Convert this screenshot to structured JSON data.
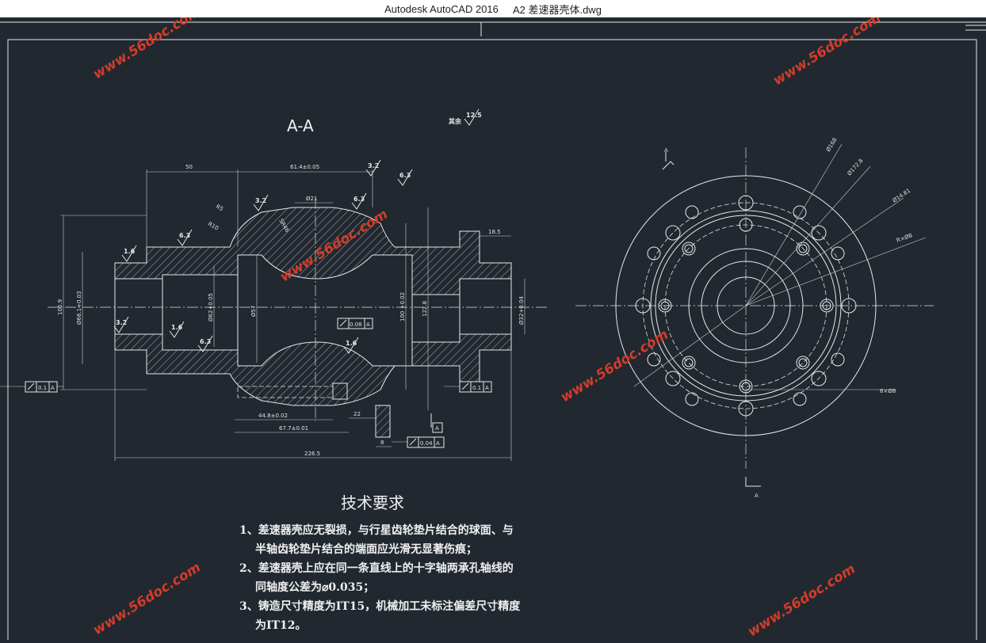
{
  "window": {
    "app": "Autodesk AutoCAD 2016",
    "file": "A2 差速器壳体.dwg"
  },
  "drawing": {
    "section_label": "A-A",
    "rough_all": "其余",
    "rough_all_value": "12.5",
    "roughness": [
      "3.2",
      "6.3",
      "1.6",
      "3.2",
      "6.3",
      "6.3",
      "3.2",
      "6.3",
      "1.6",
      "6.3",
      "1.6",
      "3.2",
      "1.6"
    ],
    "dims": {
      "d50": "50",
      "d61": "61.4±0.05",
      "d18": "18.5",
      "r5": "R5",
      "r10": "R10",
      "sr": "SR46",
      "phi21": "Ø21",
      "d106": "106.9",
      "d66": "Ø66.1+0.03",
      "d62": "Ø62+0.05",
      "d57": "Ø57",
      "d100": "100 +0.02",
      "d122": "122.8",
      "d32": "Ø32+0.04",
      "d44": "44.8±0.02",
      "d67": "67.7±0.01",
      "d22": "22",
      "d8": "8",
      "d226": "226.5"
    },
    "tol_left": {
      "value": "0.1",
      "datum": "A"
    },
    "tol_mid": {
      "value": "0.08",
      "datum": "A"
    },
    "tol_right": {
      "value": "0.1",
      "datum": "A"
    },
    "tol_bottom": {
      "value": "0.04",
      "datum": "A"
    },
    "datum_a": "A",
    "view_a_top": "A",
    "view_a_bottom": "A",
    "flange_dims": {
      "d_outer": "Ø168",
      "d_pitch": "Ø172.8",
      "d_hole": "Ø14.81",
      "r_hole": "R×Ø8",
      "six_holes": "6×Ø8"
    },
    "tech_req": {
      "title": "技术要求",
      "lines": [
        "1、差速器壳应无裂损，与行星齿轮垫片结合的球面、与",
        "半轴齿轮垫片结合的端面应光滑无显著伤痕；",
        "2、差速器壳上应在同一条直线上的十字轴两承孔轴线的",
        "同轴度公差为⌀0.035；",
        "3、铸造尺寸精度为IT15，机械加工未标注偏差尺寸精度",
        "为IT12。"
      ]
    },
    "watermark": "www.56doc.com"
  }
}
